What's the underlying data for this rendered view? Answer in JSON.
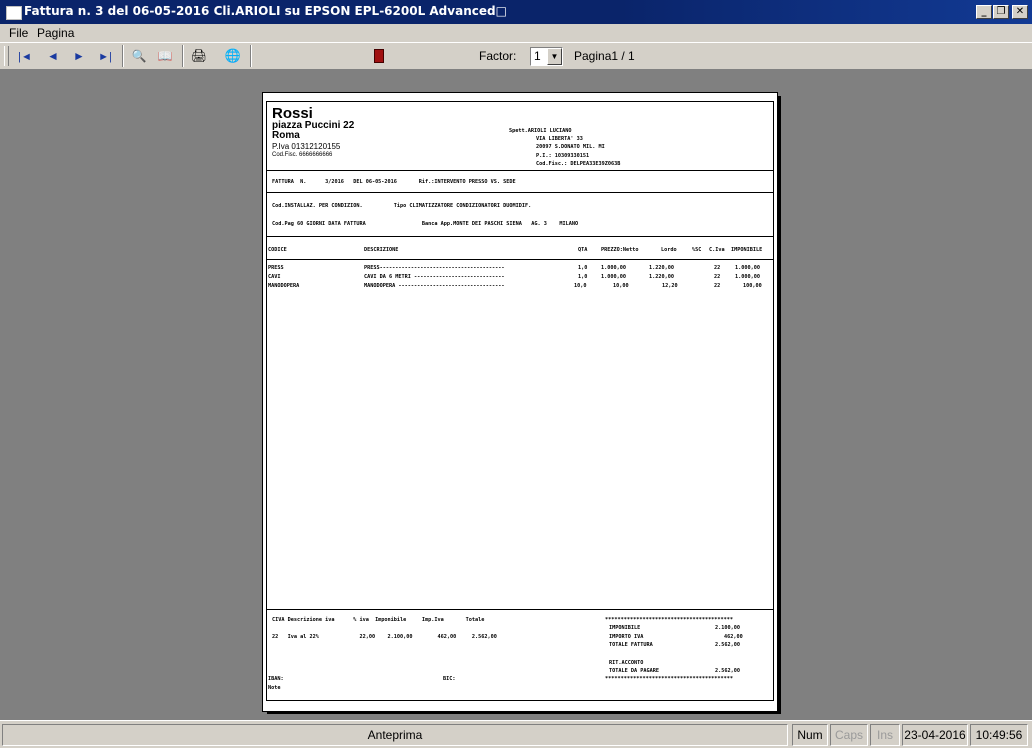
{
  "window": {
    "title": "Fattura n.   3 del 06-05-2016 Cli.ARIOLI su EPSON EPL-6200L Advanced□",
    "controls": {
      "minimize": "_",
      "restore": "❐",
      "close": "✕"
    }
  },
  "menu": {
    "items": [
      "File",
      "Pagina"
    ]
  },
  "toolbar": {
    "icons": [
      "first-page-icon",
      "prev-page-icon",
      "next-page-icon",
      "last-page-icon",
      "zoom-icon",
      "book-icon",
      "print-icon",
      "globe-icon",
      "exit-door-icon"
    ],
    "factor_label": "Factor:",
    "factor_value": "1",
    "page_label": "Pagina1 / 1"
  },
  "invoice": {
    "company": {
      "name": "Rossi",
      "address": "piazza Puccini 22",
      "city": "Roma",
      "piva": "P.Iva 01312120155",
      "cf": "Cod.Fisc. 6666666666"
    },
    "customer": {
      "line1": "Spett.ARIOLI LUCIANO",
      "line2": "VIA LIBERTA' 33",
      "line3": "20097 S.DONATO MIL. MI",
      "line4": "P.I.: 10309330151",
      "line5": "Cod.Fisc.: DELPEA33E39Z063B"
    },
    "header_line": "FATTURA  N.      3/2016   DEL 06-05-2016       Rif.:INTERVENTO PRESSO VS. SEDE",
    "info_line1": "Cod.INSTALLAZ. PER CONDIZION.          Tipo CLIMATIZZATORE CONDIZIONATORI DUOMIDIF.",
    "info_line2": "Cod.Pag 60 GIORNI DATA FATTURA                  Banca App.MONTE DEI PASCHI SIENA   AG. 3    MILANO",
    "columns": {
      "codice": "CODICE",
      "descrizione": "DESCRIZIONE",
      "qta": "QTA",
      "prezzo": "PREZZO:Netto",
      "lordo": "Lordo",
      "sc": "%SC",
      "civa": "C.Iva",
      "imponibile": "IMPONIBILE"
    },
    "rows": [
      {
        "codice": "PRESS",
        "descrizione": "PRESS----------------------------------------",
        "qta": "1,0",
        "netto": "1.000,00",
        "lordo": "1.220,00",
        "civa": "22",
        "imponibile": "1.000,00"
      },
      {
        "codice": "CAVI",
        "descrizione": "CAVI DA 6 METRI -----------------------------",
        "qta": "1,0",
        "netto": "1.000,00",
        "lordo": "1.220,00",
        "civa": "22",
        "imponibile": "1.000,00"
      },
      {
        "codice": "MANODOPERA",
        "descrizione": "MANODOPERA ----------------------------------",
        "qta": "10,0",
        "netto": "10,00",
        "lordo": "12,20",
        "civa": "22",
        "imponibile": "100,00"
      }
    ],
    "footer": {
      "vat_header": "CIVA Descrizione iva      % iva  Imponibile     Imp.Iva       Totale",
      "vat_row": "22   Iva al 22%             22,00    2.100,00        462,00     2.562,00",
      "stars_top": "*****************************************",
      "imponibile_label": "IMPONIBILE",
      "imponibile_value": "2.100,00",
      "importo_iva_label": "IMPORTO IVA",
      "importo_iva_value": "462,00",
      "totale_fattura_label": "TOTALE FATTURA",
      "totale_fattura_value": "2.562,00",
      "rit_acconto_label": "RIT.ACCONTO",
      "totale_pagare_label": "TOTALE DA PAGARE",
      "totale_pagare_value": "2.562,00",
      "stars_bottom": "*****************************************",
      "iban_label": "IBAN:",
      "bic_label": "BIC:",
      "note_label": "Note"
    }
  },
  "statusbar": {
    "main": "Anteprima",
    "num": "Num",
    "caps": "Caps",
    "ins": "Ins",
    "date": "23-04-2016",
    "time": "10:49:56"
  }
}
